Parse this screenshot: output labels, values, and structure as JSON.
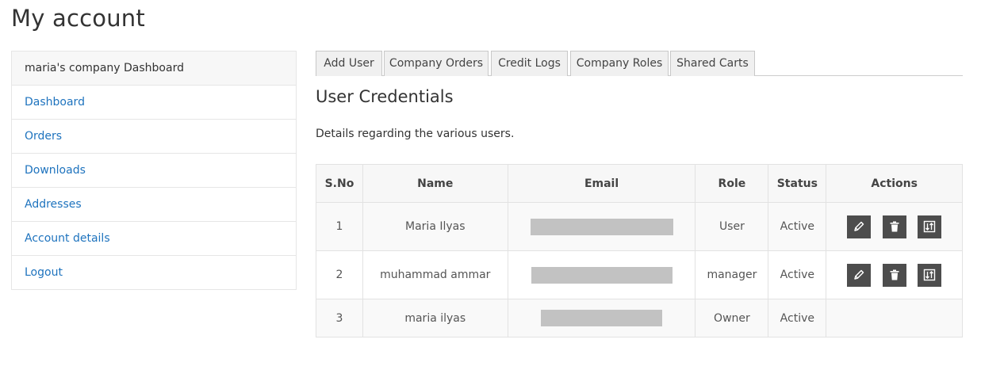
{
  "page": {
    "title": "My account"
  },
  "sidebar": {
    "header": "maria's company Dashboard",
    "items": [
      {
        "label": "Dashboard"
      },
      {
        "label": "Orders"
      },
      {
        "label": "Downloads"
      },
      {
        "label": "Addresses"
      },
      {
        "label": "Account details"
      },
      {
        "label": "Logout"
      }
    ]
  },
  "tabs": [
    {
      "label": "Add User"
    },
    {
      "label": "Company Orders"
    },
    {
      "label": "Credit Logs"
    },
    {
      "label": "Company Roles"
    },
    {
      "label": "Shared Carts"
    }
  ],
  "section": {
    "title": "User Credentials",
    "description": "Details regarding the various users."
  },
  "table": {
    "headers": [
      "S.No",
      "Name",
      "Email",
      "Role",
      "Status",
      "Actions"
    ],
    "rows": [
      {
        "sno": "1",
        "name": "Maria Ilyas",
        "email": "",
        "role": "User",
        "status": "Active",
        "actions": [
          "edit-icon",
          "trash-icon",
          "swap-icon"
        ]
      },
      {
        "sno": "2",
        "name": "muhammad ammar",
        "email": "",
        "role": "manager",
        "status": "Active",
        "actions": [
          "edit-icon",
          "trash-icon",
          "swap-icon"
        ]
      },
      {
        "sno": "3",
        "name": "maria ilyas",
        "email": "",
        "role": "Owner",
        "status": "Active",
        "actions": []
      }
    ]
  },
  "colors": {
    "link": "#1e73be",
    "action_button": "#4d4d4d",
    "redaction": "#c2c2c2"
  }
}
